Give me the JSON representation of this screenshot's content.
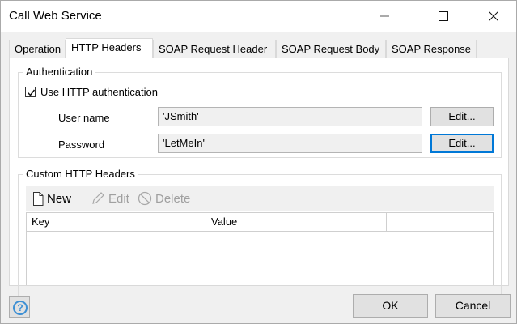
{
  "window": {
    "title": "Call Web Service",
    "minimize_icon": "minimize-icon",
    "maximize_icon": "maximize-icon",
    "close_icon": "close-icon"
  },
  "tabs": [
    {
      "label": "Operation",
      "active": false
    },
    {
      "label": "HTTP Headers",
      "active": true
    },
    {
      "label": "SOAP Request Header",
      "active": false
    },
    {
      "label": "SOAP Request Body",
      "active": false
    },
    {
      "label": "SOAP Response",
      "active": false
    }
  ],
  "authentication": {
    "legend": "Authentication",
    "use_auth_label": "Use HTTP authentication",
    "use_auth_checked": true,
    "username_label": "User name",
    "username_value": "'JSmith'",
    "username_edit": "Edit...",
    "password_label": "Password",
    "password_value": "'LetMeIn'",
    "password_edit": "Edit..."
  },
  "custom_headers": {
    "legend": "Custom HTTP Headers",
    "toolbar": {
      "new_label": "New",
      "new_icon": "document-icon",
      "edit_label": "Edit",
      "edit_icon": "pencil-icon",
      "delete_label": "Delete",
      "delete_icon": "no-entry-icon"
    },
    "columns": [
      "Key",
      "Value",
      ""
    ],
    "rows": []
  },
  "footer": {
    "help_icon": "help-icon",
    "help_glyph": "?",
    "ok_label": "OK",
    "cancel_label": "Cancel"
  },
  "colors": {
    "focus_blue": "#0078d7",
    "help_blue": "#3c8fd4",
    "disabled_text": "#a0a0a0"
  }
}
